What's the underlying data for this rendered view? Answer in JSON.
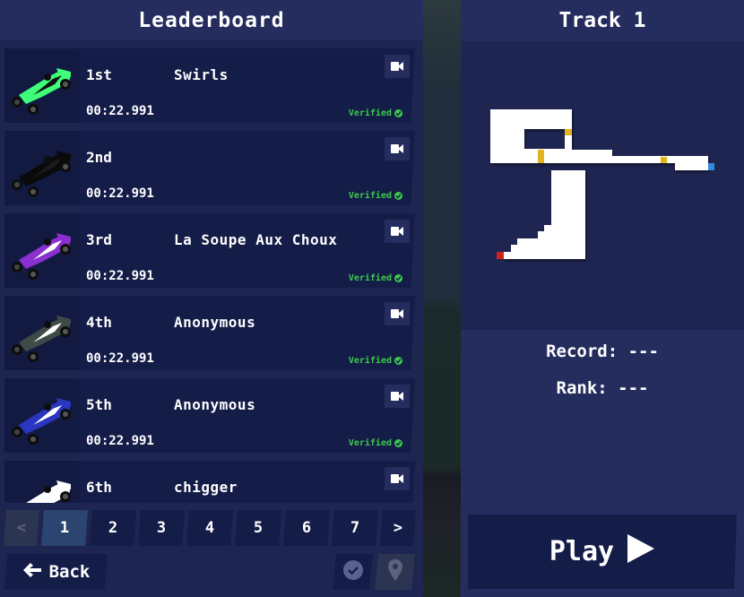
{
  "leaderboard": {
    "title": "Leaderboard",
    "entries": [
      {
        "rank": "1st",
        "name": "Swirls",
        "time": "00:22.991",
        "status": "Verified",
        "car_color": "#3dff7a",
        "car_accent": "#111111"
      },
      {
        "rank": "2nd",
        "name": "",
        "time": "00:22.991",
        "status": "Verified",
        "car_color": "#0a0a0a",
        "car_accent": "#1a1a1a"
      },
      {
        "rank": "3rd",
        "name": "La Soupe Aux Choux",
        "time": "00:22.991",
        "status": "Verified",
        "car_color": "#8a2fd0",
        "car_accent": "#ffffff"
      },
      {
        "rank": "4th",
        "name": "Anonymous",
        "time": "00:22.991",
        "status": "Verified",
        "car_color": "#3d4a46",
        "car_accent": "#ffffff"
      },
      {
        "rank": "5th",
        "name": "Anonymous",
        "time": "00:22.991",
        "status": "Verified",
        "car_color": "#2a36c0",
        "car_accent": "#ffffff"
      },
      {
        "rank": "6th",
        "name": "chigger",
        "time": "",
        "status": "",
        "car_color": "#ffffff",
        "car_accent": "#ffffff"
      }
    ]
  },
  "pagination": {
    "prev": "<",
    "next": ">",
    "pages": [
      "1",
      "2",
      "3",
      "4",
      "5",
      "6",
      "7"
    ],
    "current": "1"
  },
  "footer": {
    "back_label": "Back"
  },
  "track": {
    "title": "Track 1",
    "record_label": "Record: ---",
    "rank_label": "Rank: ---",
    "play_label": "Play"
  },
  "colors": {
    "verified": "#3cc94a",
    "start_marker": "#d02020",
    "finish_marker": "#2f8be0",
    "checkpoint": "#e0b520"
  }
}
